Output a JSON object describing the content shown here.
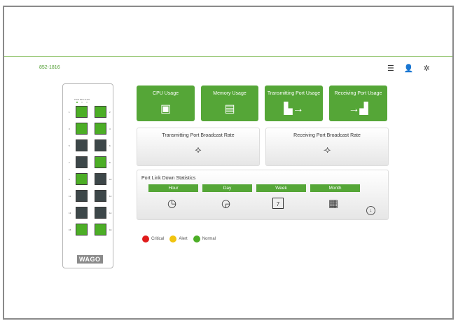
{
  "header": {
    "model": "852-1816"
  },
  "top_icons": [
    "list-settings-icon",
    "user-icon",
    "network-icon"
  ],
  "device": {
    "label": "PWR BPS ALRE",
    "leds": [
      "#4cae26",
      "#cfd9cf",
      "#cfd9cf"
    ],
    "logo": "WAGO",
    "port_numbers_left": [
      "1",
      "3",
      "5",
      "7",
      "9",
      "11",
      "13",
      "15"
    ],
    "port_numbers_right": [
      "2",
      "4",
      "6",
      "8",
      "10",
      "12",
      "14",
      "16"
    ],
    "ports_left_status": [
      "green",
      "green",
      "dark",
      "dark",
      "green",
      "dark",
      "dark",
      "green"
    ],
    "ports_right_status": [
      "green",
      "green",
      "dark",
      "green",
      "dark",
      "dark",
      "dark",
      "green"
    ]
  },
  "tiles": {
    "cpu": {
      "label": "CPU Usage",
      "icon": "cpu-icon"
    },
    "memory": {
      "label": "Memory Usage",
      "icon": "memory-icon"
    },
    "tx_port": {
      "label": "Transmitting Port Usage",
      "icon": "tx-port-icon"
    },
    "rx_port": {
      "label": "Receiving Port Usage",
      "icon": "rx-port-icon"
    }
  },
  "broadcast": {
    "tx": {
      "label": "Transmitting Port Broadcast Rate",
      "icon": "broadcast-out-icon"
    },
    "rx": {
      "label": "Receiving Port Broadcast Rate",
      "icon": "broadcast-in-icon"
    }
  },
  "link_down": {
    "title": "Port Link Down Statistics",
    "tabs": [
      "Hour",
      "Day",
      "Week",
      "Month"
    ],
    "icons": [
      "clock-icon",
      "24h-clock-icon",
      "calendar-week-icon",
      "calendar-month-icon"
    ],
    "calendar_day": "7"
  },
  "legend": [
    {
      "label": "Critical",
      "color": "#e01b1b"
    },
    {
      "label": "Alert",
      "color": "#f1c40f"
    },
    {
      "label": "Normal",
      "color": "#4cae26"
    }
  ]
}
